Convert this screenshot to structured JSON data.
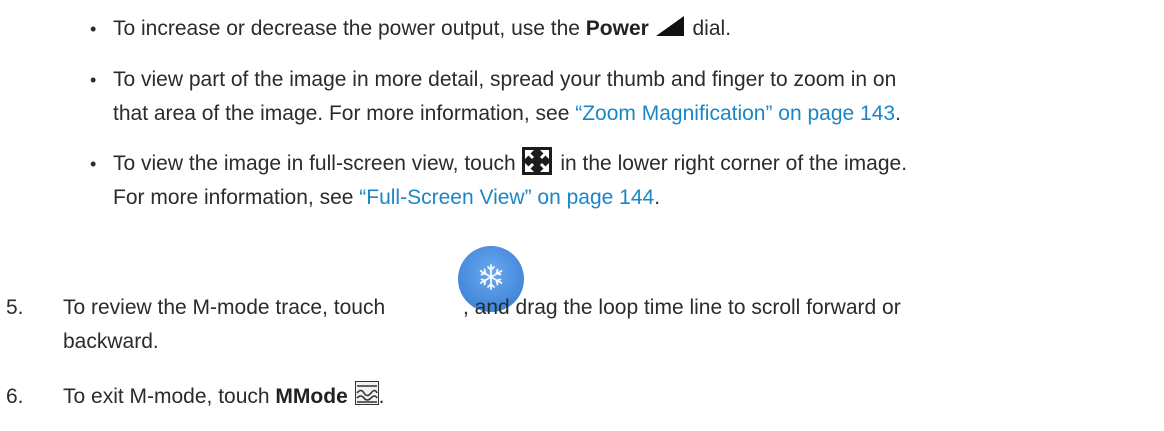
{
  "bullets": [
    {
      "pre": "To increase or decrease the power output, use the ",
      "bold": "Power",
      "icon": "power-wedge-icon",
      "post": " dial."
    },
    {
      "line1": "To view part of the image in more detail, spread your thumb and finger to zoom in on",
      "line2_pre": "that area of the image. For more information, see ",
      "link": "“Zoom Magnification” on page 143",
      "line2_post": "."
    },
    {
      "pre": "To view the image in full-screen view, touch ",
      "icon": "fullscreen-expand-icon",
      "post": " in the lower right corner of the image.",
      "line2_pre": "For more information, see ",
      "link": "“Full-Screen View” on page 144",
      "line2_post": "."
    }
  ],
  "steps": [
    {
      "number": "5.",
      "pre": "To review the M-mode trace, touch ",
      "icon": "freeze-snowflake-icon",
      "post": ", and drag the loop time line to scroll forward or",
      "line2": "backward."
    },
    {
      "number": "6.",
      "pre": "To exit M-mode, touch ",
      "bold": "MMode",
      "icon": "mmode-icon",
      "post": "."
    }
  ],
  "colors": {
    "text": "#2b2b2b",
    "link": "#1a86c8",
    "freeze_button": "#4a8fe0"
  }
}
